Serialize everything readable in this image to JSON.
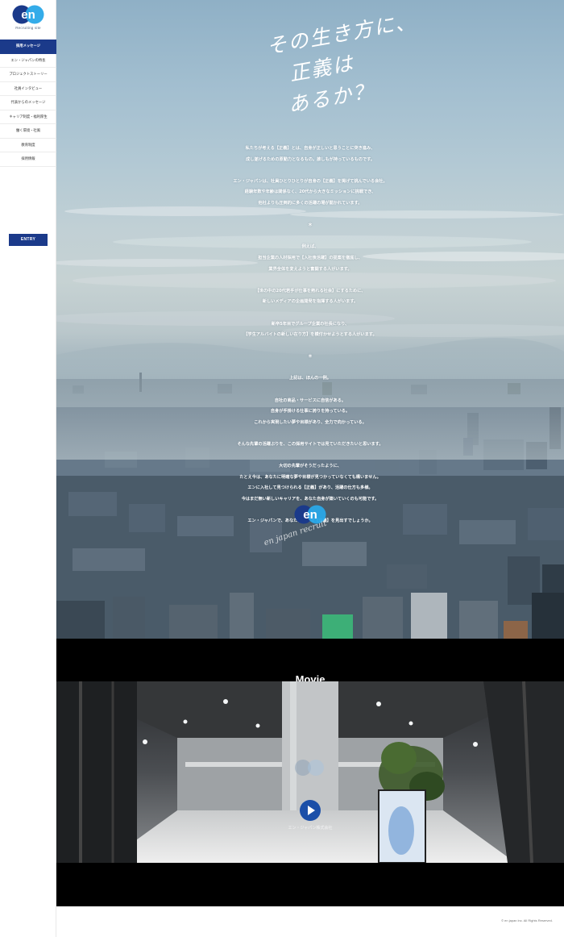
{
  "sidebar": {
    "logo_text": "en",
    "logo_sub": "Recruiting site",
    "nav": [
      "採用メッセージ",
      "エン・ジャパンの特長",
      "プロジェクトストーリー",
      "社員インタビュー",
      "代表からのメッセージ",
      "キャリア制度・福利厚生",
      "働く環境・社風",
      "教育制度",
      "採用情報"
    ],
    "entry_label": "ENTRY"
  },
  "hero": {
    "headline": [
      "その生き方に、",
      "正義は",
      "あるか？"
    ],
    "message": [
      "私たちが考える【正義】とは、自身が正しいと思うことに突き進み、",
      "成し遂げるための原動力となるもの。誰しもが持っているものです。",
      "",
      "エン・ジャパンは、社員ひとりひとりが自身の【正義】を掲げて挑んでいる会社。",
      "経験年数や年齢は関係なく、20代から大きなミッションに挑戦でき、",
      "他社よりも圧倒的に多くの活躍の場が開かれています。",
      "",
      "＊",
      "",
      "例えば、",
      "担当企業の人材採用で【入社後活躍】の提案を徹底し、",
      "業界全体を変えようと奮闘する人がいます。",
      "",
      "【世の中の20代若手が仕事を熱れる社会】にするために、",
      "新しいメディアの企画開発を指揮する人がいます。",
      "",
      "新卒5年目でグループ企業の社長になり、",
      "【学生アルバイトの新しい在り方】を模付かせようとする人がいます。",
      "",
      "＊",
      "",
      "上記は、ほんの一例。",
      "",
      "自社の商品・サービスに自信がある。",
      "自身が手掛ける仕事に誇りを持っている。",
      "これから実現したい夢や目標があり、全力で向かっている。",
      "",
      "そんな先輩の活躍ぶりを、この採用サイトでは見ていただきたいと思います。",
      "",
      "大切の先輩がそうだったように、",
      "たとえ今は、あなたに明確な夢や目標が見つかっていなくても構いません。",
      "エンに入社して見つけられる【正義】があり、活躍の仕方も多様。",
      "今はまだ無い新しいキャリアを、あなた自身が築いていくのも可能です。",
      "",
      "エン・ジャパンで、あなたはどんな【正義】を見出すでしょうか。"
    ],
    "logo_text": "en",
    "signature": "en japan recruit"
  },
  "movie": {
    "title": "Movie",
    "caption": "エン・ジャパン株式会社"
  },
  "footer": {
    "copyright": "© en japan inc. All Rights Reserved."
  },
  "colors": {
    "brand_navy": "#1b3a8a",
    "brand_blue": "#1b4fa8",
    "logo_light_blue": "#29a8e8"
  }
}
